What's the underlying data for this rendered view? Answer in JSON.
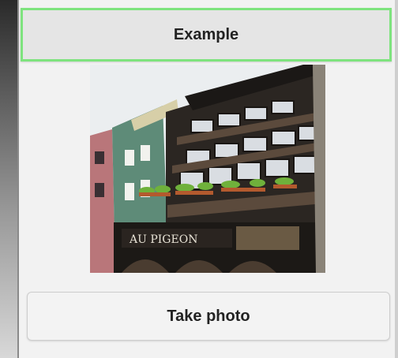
{
  "header": {
    "title": "Example"
  },
  "photo": {
    "sign_text": "AU PIGEON"
  },
  "actions": {
    "take_photo_label": "Take photo"
  }
}
